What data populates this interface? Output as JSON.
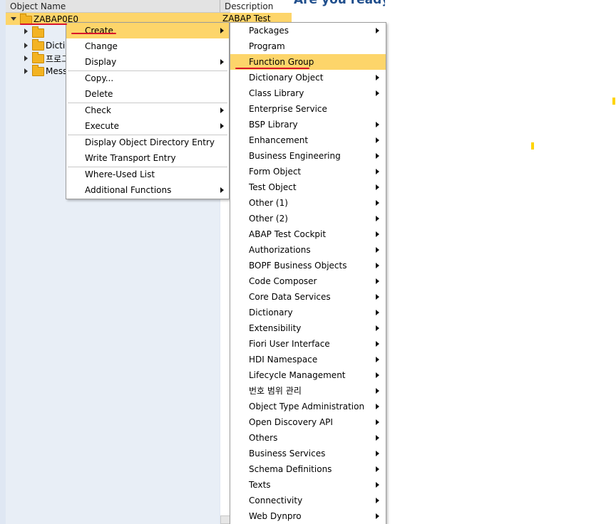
{
  "tree": {
    "columns": [
      "Object Name",
      "Description"
    ],
    "root": {
      "label": "ZABAP0E0",
      "description": "ZABAP Test"
    },
    "children": [
      {
        "label": ""
      },
      {
        "label": "Dictio"
      },
      {
        "label": "프로그"
      },
      {
        "label": "Messa"
      }
    ]
  },
  "banner": {
    "text": "Are you ready"
  },
  "context_menu": {
    "groups": [
      [
        {
          "label": "Create",
          "submenu": true,
          "highlighted": true
        },
        {
          "label": "Change",
          "submenu": false
        },
        {
          "label": "Display",
          "submenu": true
        }
      ],
      [
        {
          "label": "Copy...",
          "submenu": false
        },
        {
          "label": "Delete",
          "submenu": false
        }
      ],
      [
        {
          "label": "Check",
          "submenu": true
        },
        {
          "label": "Execute",
          "submenu": true
        }
      ],
      [
        {
          "label": "Display Object Directory Entry",
          "submenu": false
        },
        {
          "label": "Write Transport Entry",
          "submenu": false
        }
      ],
      [
        {
          "label": "Where-Used List",
          "submenu": false
        },
        {
          "label": "Additional Functions",
          "submenu": true
        }
      ]
    ]
  },
  "create_submenu": {
    "items": [
      {
        "label": "Packages",
        "submenu": true
      },
      {
        "label": "Program",
        "submenu": false
      },
      {
        "label": "Function Group",
        "submenu": false,
        "highlighted": true
      },
      {
        "label": "Dictionary Object",
        "submenu": true
      },
      {
        "label": "Class Library",
        "submenu": true
      },
      {
        "label": "Enterprise Service",
        "submenu": false
      },
      {
        "label": "BSP Library",
        "submenu": true
      },
      {
        "label": "Enhancement",
        "submenu": true
      },
      {
        "label": "Business Engineering",
        "submenu": true
      },
      {
        "label": "Form Object",
        "submenu": true
      },
      {
        "label": "Test Object",
        "submenu": true
      },
      {
        "label": "Other (1)",
        "submenu": true
      },
      {
        "label": "Other (2)",
        "submenu": true
      },
      {
        "label": "ABAP Test Cockpit",
        "submenu": true
      },
      {
        "label": "Authorizations",
        "submenu": true
      },
      {
        "label": "BOPF Business Objects",
        "submenu": true
      },
      {
        "label": "Code Composer",
        "submenu": true
      },
      {
        "label": "Core Data Services",
        "submenu": true
      },
      {
        "label": "Dictionary",
        "submenu": true
      },
      {
        "label": "Extensibility",
        "submenu": true
      },
      {
        "label": "Fiori User Interface",
        "submenu": true
      },
      {
        "label": "HDI Namespace",
        "submenu": true
      },
      {
        "label": "Lifecycle Management",
        "submenu": true
      },
      {
        "label": "번호 범위 관리",
        "submenu": true
      },
      {
        "label": "Object Type Administration",
        "submenu": true
      },
      {
        "label": "Open Discovery API",
        "submenu": true
      },
      {
        "label": "Others",
        "submenu": true
      },
      {
        "label": "Business Services",
        "submenu": true
      },
      {
        "label": "Schema Definitions",
        "submenu": true
      },
      {
        "label": "Texts",
        "submenu": true
      },
      {
        "label": "Connectivity",
        "submenu": true
      },
      {
        "label": "Web Dynpro",
        "submenu": true
      }
    ]
  },
  "colors": {
    "highlight": "#fdd56a",
    "annotation": "#d9142a",
    "tree_bg": "#e8eef6"
  }
}
